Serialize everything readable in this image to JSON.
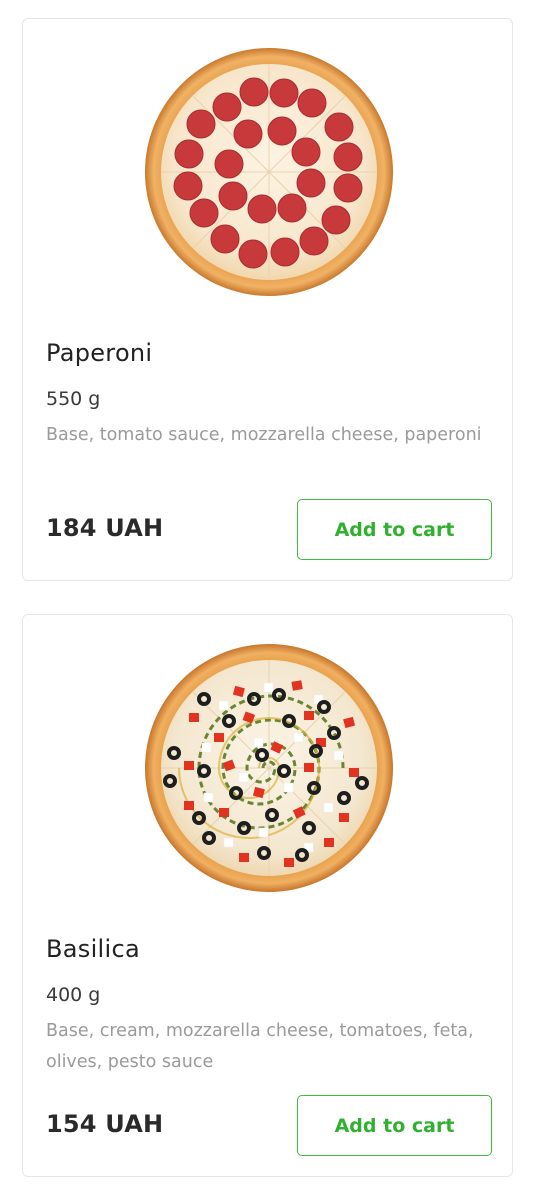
{
  "products": [
    {
      "name": "Paperoni",
      "weight": "550 g",
      "description": "Base, tomato sauce, mozzarella cheese, paperoni",
      "price": "184 UAH",
      "button_label": "Add to cart",
      "image_icon": "pepperoni-pizza-image"
    },
    {
      "name": "Basilica",
      "weight": "400 g",
      "description": "Base, cream, mozzarella cheese, tomatoes, feta, olives, pesto sauce",
      "price": "154 UAH",
      "button_label": "Add to cart",
      "image_icon": "basilica-pizza-image"
    }
  ],
  "colors": {
    "accent": "#3fb93f",
    "card_border": "#e6e6e6",
    "muted_text": "#9a9a9a"
  }
}
